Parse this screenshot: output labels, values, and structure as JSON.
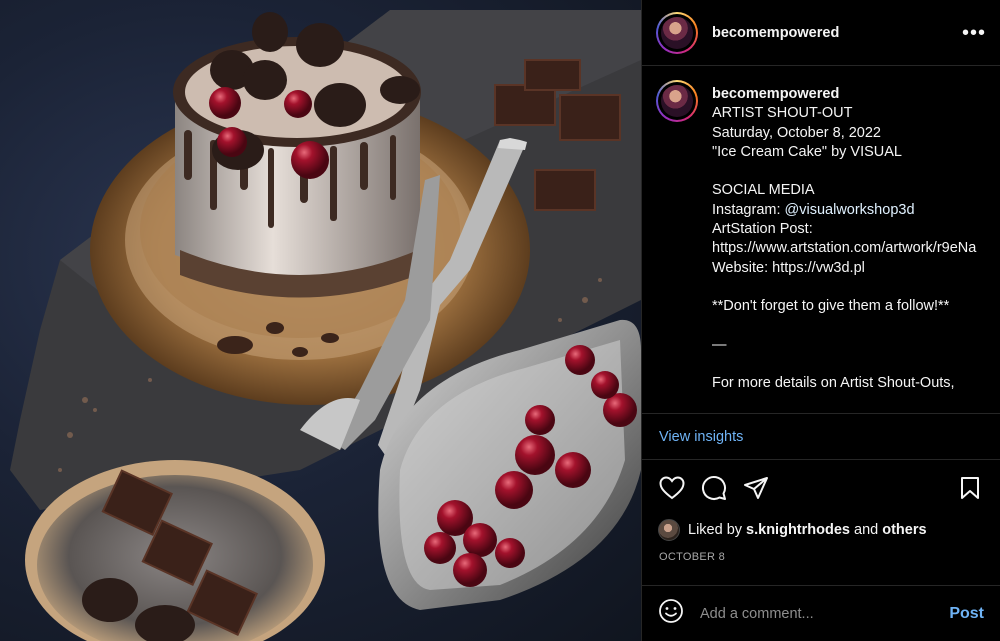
{
  "post": {
    "username": "becomempowered",
    "image_alt": "Ice cream cake with cherries and chocolate on a wooden board"
  },
  "header": {
    "username": "becomempowered",
    "more_icon": "more-horizontal-icon"
  },
  "caption": {
    "username": "becomempowered",
    "lines": [
      "ARTIST SHOUT-OUT",
      "Saturday, October 8, 2022",
      "\"Ice Cream Cake\" by VISUAL",
      "",
      "SOCIAL MEDIA"
    ],
    "instagram_label": "Instagram: ",
    "instagram_handle": "@visualworkshop3d",
    "lines_after": [
      "ArtStation Post:",
      "https://www.artstation.com/artwork/r9eNa",
      "Website: https://vw3d.pl",
      "",
      "**Don't forget to give them a follow!**",
      "",
      "—",
      "",
      "For more details on Artist Shout-Outs,"
    ]
  },
  "insights": {
    "label": "View insights"
  },
  "actions": {
    "like_icon": "heart-icon",
    "comment_icon": "comment-icon",
    "share_icon": "share-icon",
    "save_icon": "bookmark-icon"
  },
  "likes": {
    "prefix": "Liked by ",
    "user": "s.knightrhodes",
    "middle": " and ",
    "others": "others"
  },
  "date": "OCTOBER 8",
  "comment": {
    "placeholder": "Add a comment...",
    "post_label": "Post",
    "emoji_icon": "smiley-icon"
  },
  "colors": {
    "background": "#000000",
    "link": "#6fb3f5",
    "divider": "#262626",
    "muted": "#a8a8a8"
  }
}
